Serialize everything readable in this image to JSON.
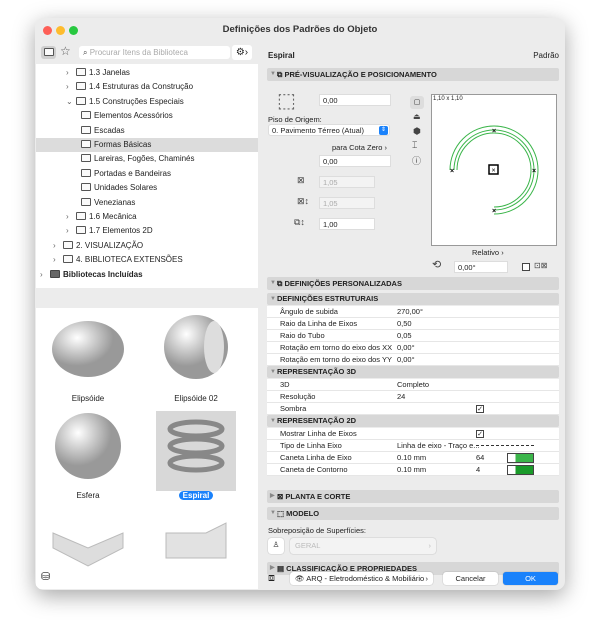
{
  "window": {
    "title": "Definições dos Padrões do Objeto"
  },
  "library": {
    "search_placeholder": "Procurar Itens da Biblioteca",
    "tree": [
      {
        "label": "1.3 Janelas",
        "level": 2,
        "expander": "›"
      },
      {
        "label": "1.4 Estruturas da Construção",
        "level": 2,
        "expander": "›"
      },
      {
        "label": "1.5 Construções Especiais",
        "level": 2,
        "expander": "⌄"
      },
      {
        "label": "Elementos Acessórios",
        "level": 3,
        "expander": ""
      },
      {
        "label": "Escadas",
        "level": 3,
        "expander": ""
      },
      {
        "label": "Formas Básicas",
        "level": 3,
        "expander": "",
        "selected": true
      },
      {
        "label": "Lareiras, Fogões, Chaminés",
        "level": 3,
        "expander": ""
      },
      {
        "label": "Portadas e Bandeiras",
        "level": 3,
        "expander": ""
      },
      {
        "label": "Unidades Solares",
        "level": 3,
        "expander": ""
      },
      {
        "label": "Venezianas",
        "level": 3,
        "expander": ""
      },
      {
        "label": "1.6 Mecânica",
        "level": 2,
        "expander": "›"
      },
      {
        "label": "1.7 Elementos 2D",
        "level": 2,
        "expander": "›"
      },
      {
        "label": "2. VISUALIZAÇÃO",
        "level": 1,
        "expander": "›"
      },
      {
        "label": "4. BIBLIOTECA EXTENSÕES",
        "level": 1,
        "expander": "›"
      },
      {
        "label": "Bibliotecas Incluídas",
        "level": 0,
        "expander": "›",
        "bold": true
      }
    ],
    "thumbnails": [
      {
        "label": "Elipsóide"
      },
      {
        "label": "Elipsóide 02"
      },
      {
        "label": "Esfera"
      },
      {
        "label": "Espiral",
        "selected": true
      },
      {
        "label": ""
      },
      {
        "label": ""
      }
    ]
  },
  "object": {
    "name": "Espiral",
    "default_label": "Padrão"
  },
  "preview": {
    "section": "PRÉ-VISUALIZAÇÃO E POSICIONAMENTO",
    "elevation": "0,00",
    "story_label": "Piso de Origem:",
    "story_value": "0. Pavimento Térreo (Atual)",
    "zero_ref": "para Cota Zero",
    "zero_value": "0,00",
    "width": "1,05",
    "depth": "1,05",
    "height": "1,00",
    "preview_size": "1,10 x 1,10",
    "relative": "Relativo",
    "angle": "0,00°"
  },
  "custom": {
    "section": "DEFINIÇÕES PERSONALIZADAS",
    "groups": [
      {
        "title": "DEFINIÇÕES ESTRUTURAIS",
        "rows": [
          {
            "k": "Ângulo de subida",
            "v": "270,00°"
          },
          {
            "k": "Raio da Linha de Eixos",
            "v": "0,50"
          },
          {
            "k": "Raio do Tubo",
            "v": "0,05"
          },
          {
            "k": " Rotação em torno do eixo dos XX",
            "v": "0,00°"
          },
          {
            "k": " Rotação em torno do eixo dos YY",
            "v": "0,00°"
          }
        ]
      },
      {
        "title": "REPRESENTAÇÃO 3D",
        "rows": [
          {
            "k": "3D",
            "v": "Completo"
          },
          {
            "k": "Resolução",
            "v": "24"
          },
          {
            "k": "Sombra",
            "v": "",
            "check": true
          }
        ]
      },
      {
        "title": "REPRESENTAÇÃO 2D",
        "rows": [
          {
            "k": "Mostrar Linha de Eixos",
            "v": "",
            "check": true
          },
          {
            "k": "Tipo de Linha Eixo",
            "v": "Linha de eixo - Traço e..."
          },
          {
            "k": "Caneta Linha de Eixo",
            "v": "0.10 mm",
            "n": "64",
            "pen": "#3bb54a"
          },
          {
            "k": "Caneta de Contorno",
            "v": "0.10 mm",
            "n": "4",
            "pen": "#1a9a2a"
          }
        ]
      }
    ]
  },
  "plan": {
    "section": "PLANTA E CORTE"
  },
  "model": {
    "section": "MODELO",
    "surface_label": "Sobreposição de Superfícies:",
    "surface_value": "GERAL"
  },
  "classification": {
    "section": "CLASSIFICAÇÃO E PROPRIEDADES"
  },
  "footer": {
    "layer": "ARQ - Eletrodoméstico & Mobiliário",
    "cancel": "Cancelar",
    "ok": "OK"
  },
  "colors": {
    "accent": "#1a82fb",
    "preview_line": "#3bb54a"
  }
}
